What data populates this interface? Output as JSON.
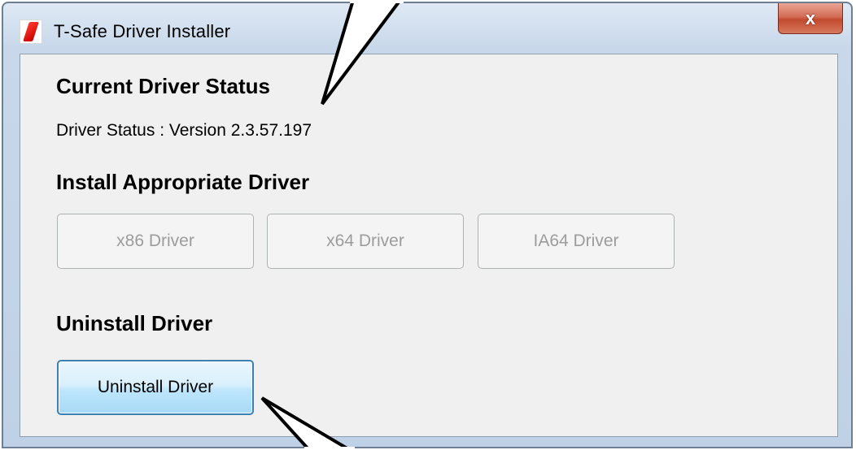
{
  "window": {
    "title": "T-Safe Driver Installer",
    "close_symbol": "x"
  },
  "sections": {
    "status_heading": "Current Driver Status",
    "status_text": "Driver Status : Version 2.3.57.197",
    "install_heading": "Install Appropriate Driver",
    "uninstall_heading": "Uninstall Driver"
  },
  "buttons": {
    "x86": "x86 Driver",
    "x64": "x64 Driver",
    "ia64": "IA64 Driver",
    "uninstall": "Uninstall Driver"
  },
  "colors": {
    "close_button": "#c14a2f",
    "focus_button_border": "#3c7fb1",
    "disabled_text": "#9c9c9c"
  }
}
